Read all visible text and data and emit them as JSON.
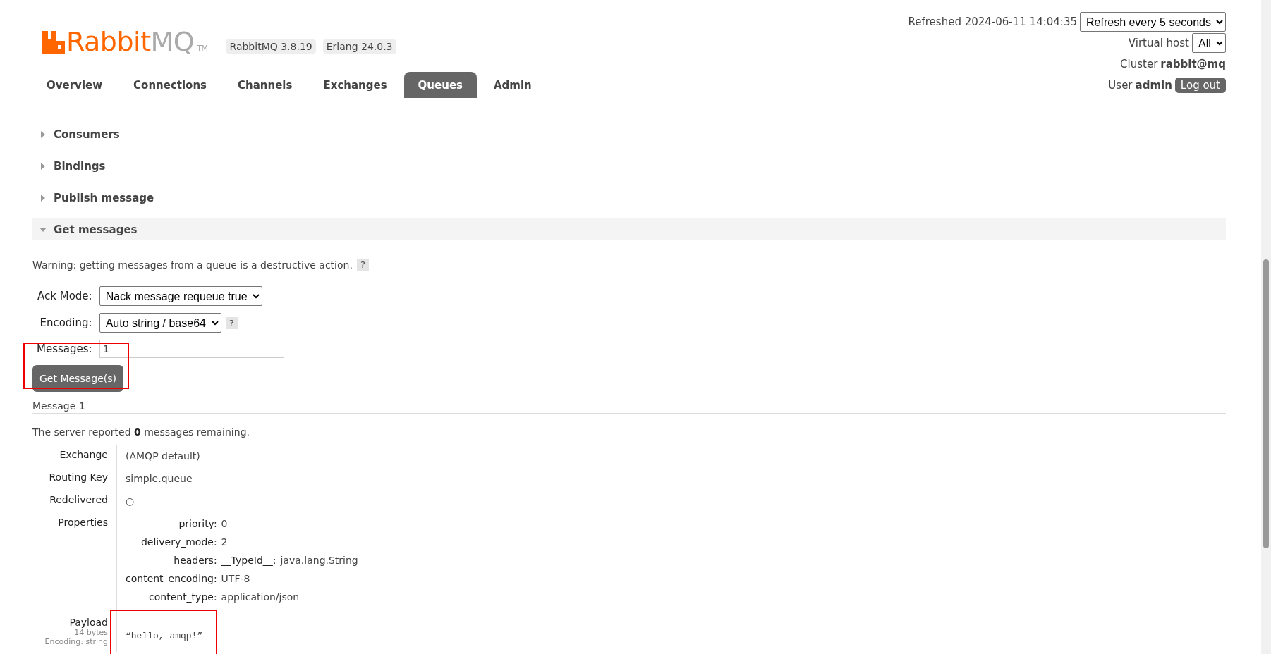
{
  "logo": {
    "brand": "Rabbit",
    "product": "MQ",
    "trademark": "TM"
  },
  "versions": [
    "RabbitMQ 3.8.19",
    "Erlang 24.0.3"
  ],
  "refreshed": "Refreshed 2024-06-11 14:04:35",
  "refresh_select": "Refresh every 5 seconds",
  "virtual_host": {
    "label": "Virtual host",
    "value": "All"
  },
  "cluster": {
    "label": "Cluster",
    "value": "rabbit@mq"
  },
  "user": {
    "label": "User",
    "value": "admin"
  },
  "logout_button": "Log out",
  "tabs": [
    {
      "label": "Overview",
      "selected": false
    },
    {
      "label": "Connections",
      "selected": false
    },
    {
      "label": "Channels",
      "selected": false
    },
    {
      "label": "Exchanges",
      "selected": false
    },
    {
      "label": "Queues",
      "selected": true
    },
    {
      "label": "Admin",
      "selected": false
    }
  ],
  "sections": [
    {
      "title": "Consumers",
      "expanded": false
    },
    {
      "title": "Bindings",
      "expanded": false
    },
    {
      "title": "Publish message",
      "expanded": false
    },
    {
      "title": "Get messages",
      "expanded": true
    }
  ],
  "get_messages": {
    "warning": "Warning: getting messages from a queue is a destructive action.",
    "help": "?",
    "fields": [
      {
        "kind": "select",
        "label": "Ack Mode:",
        "value": "Nack message requeue true"
      },
      {
        "kind": "select",
        "label": "Encoding:",
        "value": "Auto string / base64",
        "help": "?"
      },
      {
        "kind": "input",
        "label": "Messages:",
        "value": "1"
      }
    ],
    "button": {
      "label": "Get Message(s)",
      "highlighted": true
    }
  },
  "message": {
    "title": "Message 1",
    "remaining": "The server reported **0** messages remaining.",
    "rows": [
      {
        "label": "Exchange",
        "value": "(AMQP default)"
      },
      {
        "label": "Routing Key",
        "value": "simple.queue"
      },
      {
        "label": "Redelivered",
        "value": "○"
      }
    ],
    "properties": {
      "label": "Properties",
      "items": [
        {
          "key": "priority:",
          "value": "0"
        },
        {
          "key": "delivery_mode:",
          "value": "2"
        },
        {
          "key": "headers:",
          "subkey": "__TypeId__:",
          "value": "java.lang.String"
        },
        {
          "key": "content_encoding:",
          "value": "UTF-8"
        },
        {
          "key": "content_type:",
          "value": "application/json"
        }
      ]
    },
    "payload": {
      "label": "Payload",
      "size": "14 bytes",
      "encoding": "Encoding: string",
      "value": "“hello, amqp!”",
      "highlighted": true
    }
  }
}
